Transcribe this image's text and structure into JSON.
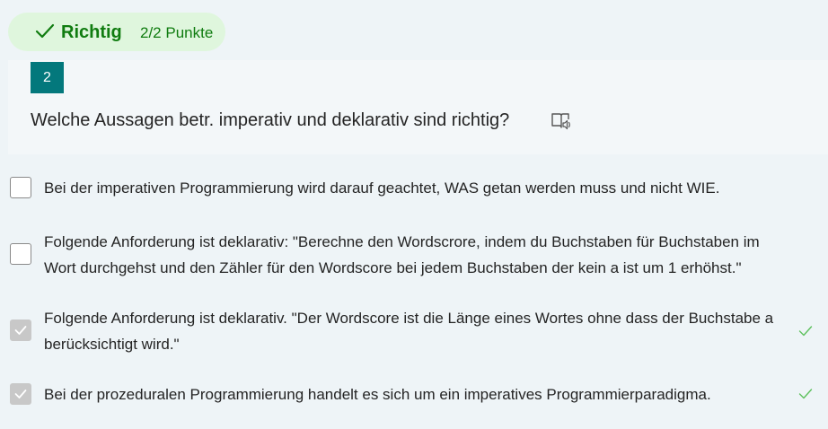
{
  "result": {
    "status": "Richtig",
    "score": "2/2 Punkte"
  },
  "question": {
    "number": "2",
    "text": "Welche Aussagen betr. imperativ und deklarativ sind richtig?",
    "reader_icon": "immersive-reader-icon"
  },
  "options": [
    {
      "text": "Bei der imperativen Programmierung wird darauf geachtet, WAS getan werden muss und nicht WIE.",
      "checked": false,
      "correct": false
    },
    {
      "text": "Folgende Anforderung ist deklarativ: \"Berechne den Wordscrore, indem du Buchstaben für Buchstaben im Wort durchgehst und den Zähler für den Wordscore bei jedem Buchstaben der kein a ist um 1 erhöhst.\"",
      "checked": false,
      "correct": false
    },
    {
      "text": "Folgende Anforderung ist deklarativ. \"Der Wordscore ist die Länge eines Wortes ohne dass der Buchstabe a berücksichtigt wird.\"",
      "checked": true,
      "correct": true
    },
    {
      "text": "Bei der prozeduralen Programmierung handelt es sich um ein imperatives Programmierparadigma.",
      "checked": true,
      "correct": true
    }
  ],
  "colors": {
    "accent": "#03787c",
    "success": "#107c10",
    "success_bg": "#dff6dd",
    "checked_box": "#c8c8c8"
  }
}
